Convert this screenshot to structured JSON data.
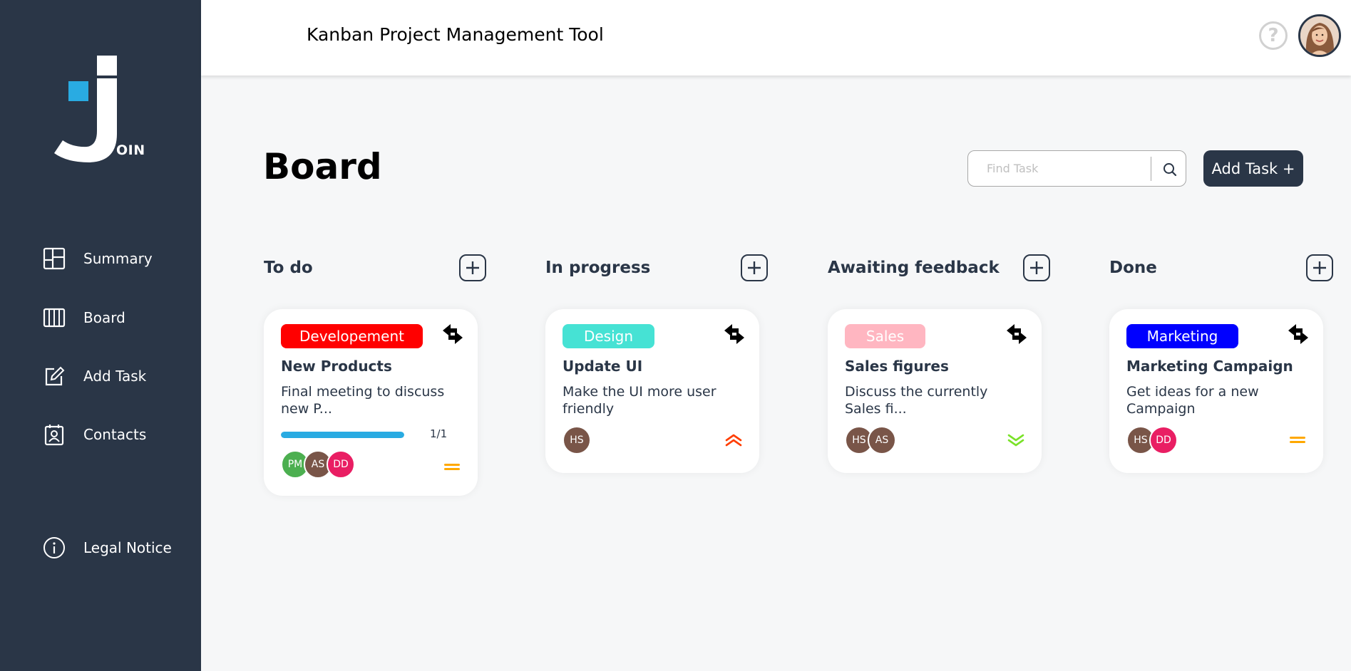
{
  "brand": {
    "logo_text": "OIN",
    "blue": "#29abe2",
    "dark": "#2a3647"
  },
  "sidebar": {
    "items": [
      {
        "label": "Summary",
        "icon": "summary-icon"
      },
      {
        "label": "Board",
        "icon": "board-icon"
      },
      {
        "label": "Add Task",
        "icon": "add-task-icon"
      },
      {
        "label": "Contacts",
        "icon": "contacts-icon"
      }
    ],
    "legal": {
      "label": "Legal Notice",
      "icon": "info-icon"
    }
  },
  "header": {
    "title": "Kanban Project Management Tool",
    "help": "?"
  },
  "board": {
    "title": "Board",
    "search_placeholder": "Find Task",
    "add_task_label": "Add Task +"
  },
  "columns": [
    {
      "title": "To do"
    },
    {
      "title": "In progress"
    },
    {
      "title": "Awaiting feedback"
    },
    {
      "title": "Done"
    }
  ],
  "cards": [
    {
      "tag": "Developement",
      "tag_color": "#ff0000",
      "title": "New Products",
      "description": "Final meeting to discuss new P...",
      "progress": 1.0,
      "progress_label": "1/1",
      "assignees": [
        {
          "initials": "PM",
          "color": "#4caf50"
        },
        {
          "initials": "AS",
          "color": "#795548"
        },
        {
          "initials": "DD",
          "color": "#e91e63"
        }
      ],
      "priority": "medium",
      "priority_color": "#ffa800"
    },
    {
      "tag": "Design",
      "tag_color": "#46e2d4",
      "title": "Update UI",
      "description": "Make the UI more user friendly",
      "assignees": [
        {
          "initials": "HS",
          "color": "#795548"
        }
      ],
      "priority": "urgent",
      "priority_color": "#ff3d00"
    },
    {
      "tag": "Sales",
      "tag_color": "#ffb6c1",
      "title": "Sales figures",
      "description": "Discuss the currently Sales fi...",
      "assignees": [
        {
          "initials": "HS",
          "color": "#795548"
        },
        {
          "initials": "AS",
          "color": "#795548"
        }
      ],
      "priority": "low",
      "priority_color": "#7ae229"
    },
    {
      "tag": "Marketing",
      "tag_color": "#0000ff",
      "title": "Marketing Campaign",
      "description": "Get ideas for a new Campaign",
      "assignees": [
        {
          "initials": "HS",
          "color": "#795548"
        },
        {
          "initials": "DD",
          "color": "#e91e63"
        }
      ],
      "priority": "medium",
      "priority_color": "#ffa800"
    }
  ]
}
